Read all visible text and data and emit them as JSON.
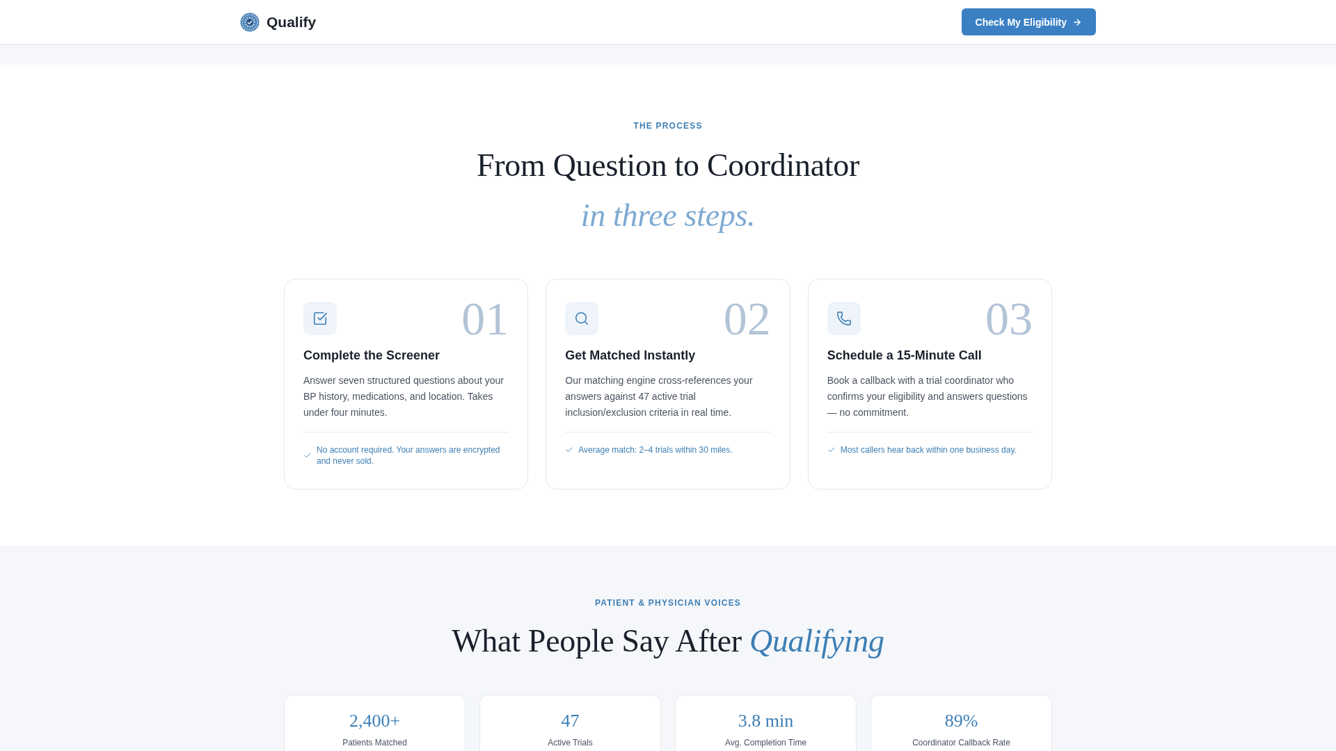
{
  "header": {
    "brand": "Qualify",
    "cta": {
      "label": "Check My Eligibility"
    }
  },
  "process": {
    "eyebrow": "THE PROCESS",
    "title": "From Question to Coordinator",
    "subtitle": "in three steps.",
    "steps": [
      {
        "kind": "screener",
        "number": "01",
        "title": "Complete the Screener",
        "description": "Answer seven structured questions about your BP history, medications, and location. Takes under four minutes.",
        "note": "No account required. Your answers are encrypted and never sold."
      },
      {
        "kind": "match",
        "number": "02",
        "title": "Get Matched Instantly",
        "description": "Our matching engine cross-references your answers against 47 active trial inclusion/exclusion criteria in real time.",
        "note": "Average match: 2–4 trials within 30 miles."
      },
      {
        "kind": "call",
        "number": "03",
        "title": "Schedule a 15-Minute Call",
        "description": "Book a callback with a trial coordinator who confirms your eligibility and answers questions — no commitment.",
        "note": "Most callers hear back within one business day."
      }
    ]
  },
  "voices": {
    "eyebrow": "PATIENT & PHYSICIAN VOICES",
    "title": "What People Say After *Qualifying*",
    "stats": [
      {
        "value": "2,400+",
        "label": "Patients Matched"
      },
      {
        "value": "47",
        "label": "Active Trials"
      },
      {
        "value": "3.8 min",
        "label": "Avg. Completion Time"
      },
      {
        "value": "89%",
        "label": "Coordinator Callback Rate"
      }
    ]
  }
}
